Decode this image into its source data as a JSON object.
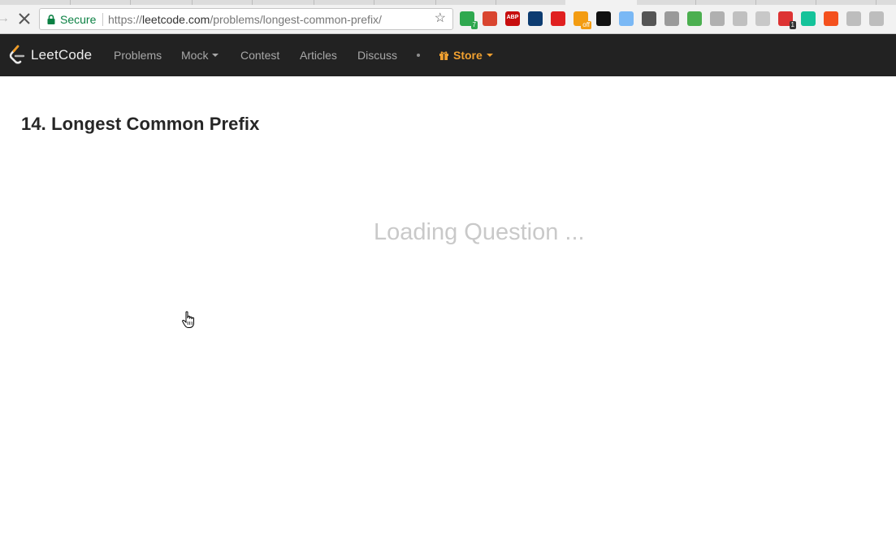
{
  "browser": {
    "security_label": "Secure",
    "url_scheme": "https://",
    "url_host": "leetcode.com",
    "url_path": "/problems/longest-common-prefix/",
    "extensions": [
      {
        "name": "grammarly-like-icon",
        "color": "#2fa84f",
        "badge": "7"
      },
      {
        "name": "santa-icon",
        "color": "#d9452f"
      },
      {
        "name": "adblock-plus-icon",
        "color": "#c70d0d",
        "label": "ABP"
      },
      {
        "name": "cloud-icon",
        "color": "#0d3c71"
      },
      {
        "name": "shield-icon",
        "color": "#e02020"
      },
      {
        "name": "honey-off-icon",
        "color": "#f39c12",
        "badge": "off"
      },
      {
        "name": "tab-icon",
        "color": "#111111"
      },
      {
        "name": "snowflake-icon",
        "color": "#7ab8f5"
      },
      {
        "name": "cast-icon",
        "color": "#555555"
      },
      {
        "name": "hanger-icon",
        "color": "#9a9a9a"
      },
      {
        "name": "wand-icon",
        "color": "#4caf50"
      },
      {
        "name": "drive-icon",
        "color": "#b0b0b0"
      },
      {
        "name": "camera-icon",
        "color": "#c0c0c0"
      },
      {
        "name": "refresh-ext-icon",
        "color": "#c8c8c8"
      },
      {
        "name": "todo-icon",
        "color": "#d33",
        "badge": "1"
      },
      {
        "name": "grammarly-icon",
        "color": "#15c39a"
      },
      {
        "name": "favorite-icon",
        "color": "#f4511e"
      },
      {
        "name": "profile-icon",
        "color": "#bdbdbd"
      },
      {
        "name": "bolt-icon",
        "color": "#bdbdbd"
      }
    ]
  },
  "nav": {
    "brand": "LeetCode",
    "items": [
      "Problems",
      "Mock",
      "Contest",
      "Articles",
      "Discuss"
    ],
    "store": "Store",
    "store_color": "#f0a030"
  },
  "problem": {
    "title": "14. Longest Common Prefix",
    "loading": "Loading Question ..."
  }
}
